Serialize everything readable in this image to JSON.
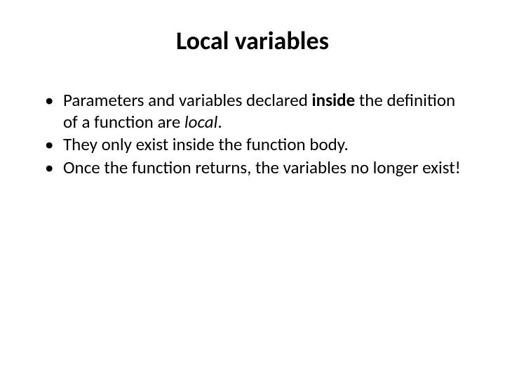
{
  "slide": {
    "title": "Local variables",
    "bullets": [
      {
        "pre": "Parameters and variables declared ",
        "emph": "inside",
        "emph_type": "bold",
        "mid": " the definition of a function are ",
        "emph2": "local",
        "emph2_type": "italic",
        "post": "."
      },
      {
        "pre": "They only exist inside the function body.",
        "emph": "",
        "emph_type": "",
        "mid": "",
        "emph2": "",
        "emph2_type": "",
        "post": ""
      },
      {
        "pre": "Once the function returns, the variables no longer exist!",
        "emph": "",
        "emph_type": "",
        "mid": "",
        "emph2": "",
        "emph2_type": "",
        "post": ""
      }
    ]
  }
}
